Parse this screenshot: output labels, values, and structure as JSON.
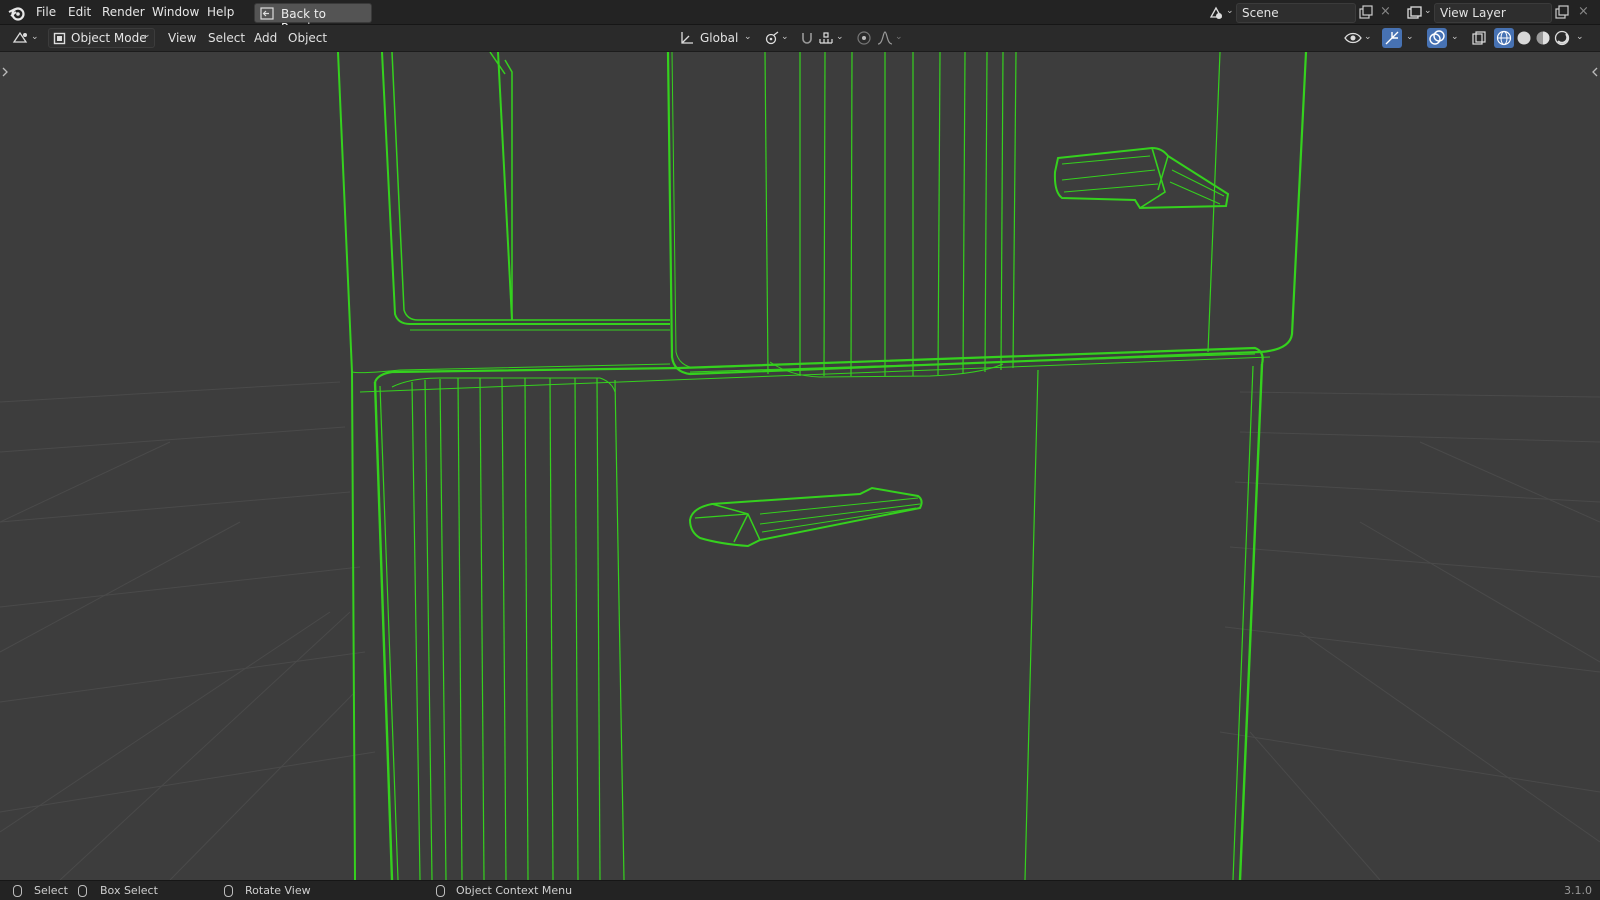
{
  "menu": {
    "items": [
      "File",
      "Edit",
      "Render",
      "Window",
      "Help"
    ],
    "back_button": "Back to Previous"
  },
  "scene": {
    "scene_label": "Scene",
    "view_layer_label": "View Layer"
  },
  "header": {
    "mode": "Object Mode",
    "menus": [
      "View",
      "Select",
      "Add",
      "Object"
    ],
    "transform_orientation": "Global"
  },
  "status": {
    "select": "Select",
    "box_select": "Box Select",
    "rotate_view": "Rotate View",
    "context_menu": "Object Context Menu",
    "version": "3.1.0"
  },
  "colors": {
    "wire": "#35d11e",
    "viewport_bg": "#3d3d3d",
    "grid": "#4a4a4a"
  }
}
